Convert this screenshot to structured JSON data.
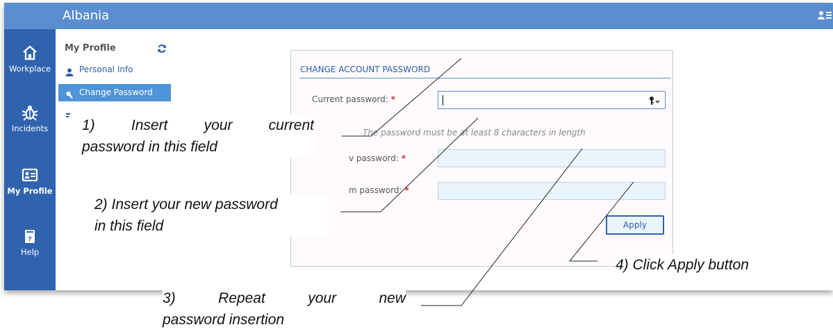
{
  "topbar": {
    "title": "Albania"
  },
  "nav": {
    "items": [
      {
        "label": "Workplace",
        "icon": "home-icon"
      },
      {
        "label": "Incidents",
        "icon": "bug-icon"
      },
      {
        "label": "My Profile",
        "icon": "id-card-icon"
      },
      {
        "label": "Help",
        "icon": "help-book-icon"
      }
    ],
    "active": "My Profile"
  },
  "submenu": {
    "title": "My Profile",
    "items": [
      {
        "label": "Personal Info",
        "icon": "user-icon"
      },
      {
        "label": "Change Password",
        "icon": "password-icon"
      }
    ]
  },
  "panel": {
    "title": "CHANGE ACCOUNT PASSWORD",
    "current_label": "Current password:",
    "required_mark": "*",
    "hint": "The password must be at least 8 characters in length",
    "new_label": "v password:",
    "confirm_label": "m password:",
    "apply_label": "Apply"
  },
  "callouts": {
    "c1_line1_words": [
      "1)",
      "Insert",
      "your",
      "current"
    ],
    "c1_line2": "password in this field",
    "c2_line1": "2) Insert your new password",
    "c2_line2": "in this field",
    "c3_line1_words": [
      "3)",
      "Repeat",
      "your",
      "new"
    ],
    "c3_line2": "password insertion",
    "c4": "4) Click Apply button"
  },
  "colors": {
    "topbar": "#5b8ed1",
    "nav": "#2f63ae",
    "accent": "#4f93d8",
    "required": "#c0392b"
  }
}
